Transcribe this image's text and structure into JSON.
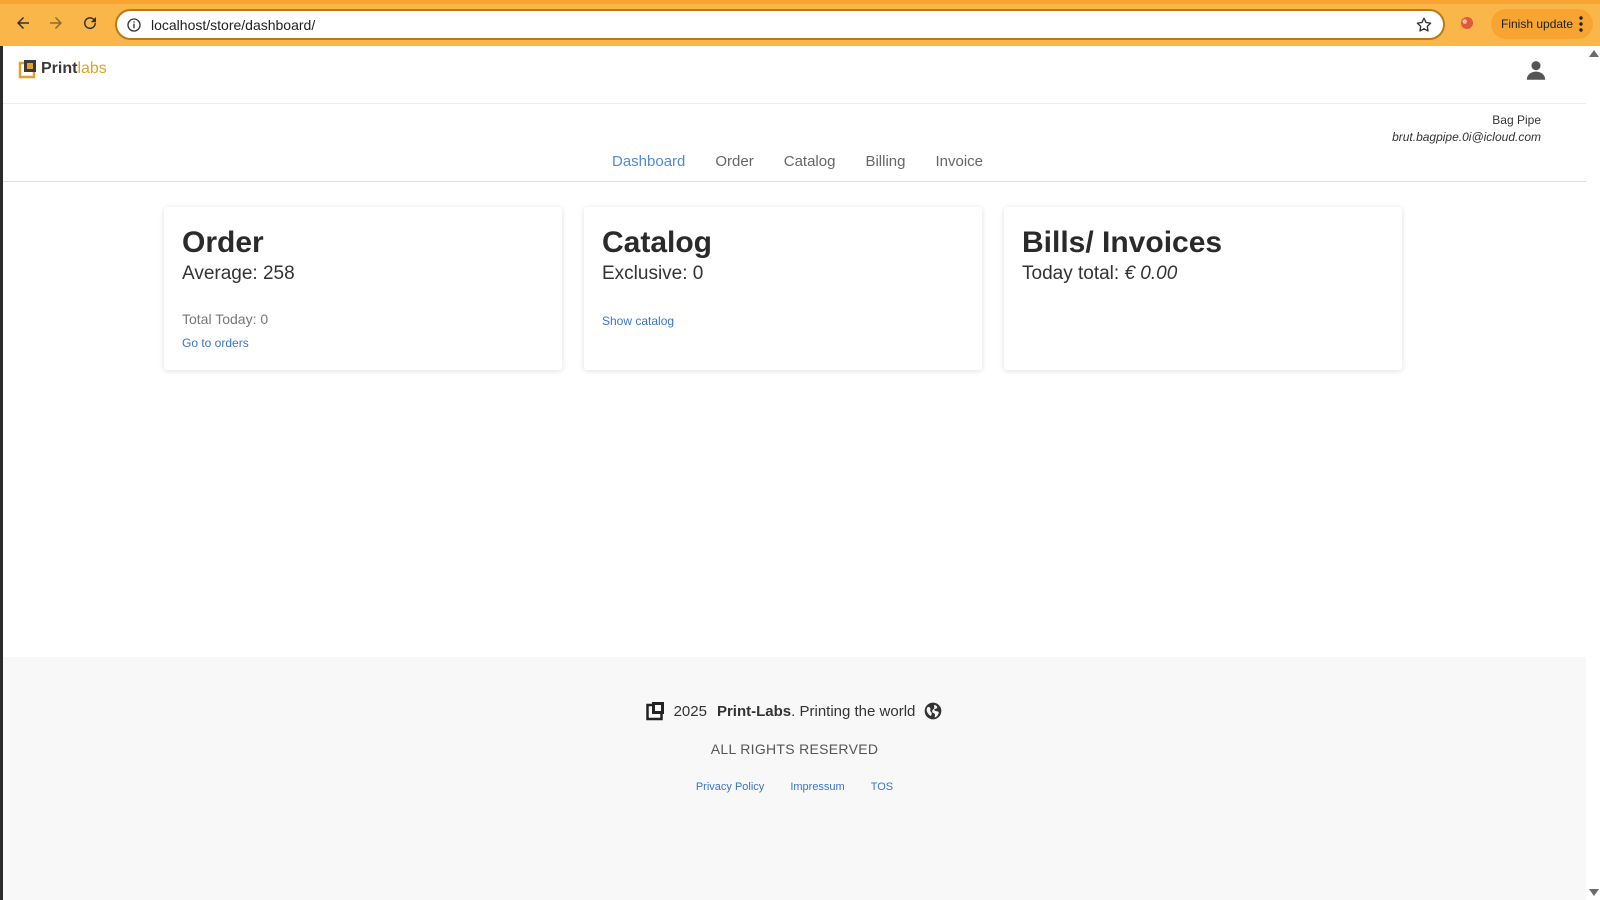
{
  "browser": {
    "url": "localhost/store/dashboard/",
    "finish_update_label": "Finish update"
  },
  "header": {
    "logo_part1": "Print",
    "logo_part2": "labs"
  },
  "user": {
    "name": "Bag Pipe",
    "email": "brut.bagpipe.0i@icloud.com"
  },
  "tabs": [
    {
      "label": "Dashboard",
      "active": true
    },
    {
      "label": "Order"
    },
    {
      "label": "Catalog"
    },
    {
      "label": "Billing"
    },
    {
      "label": "Invoice"
    }
  ],
  "cards": {
    "order": {
      "title": "Order",
      "average": "Average: 258",
      "total_today": "Total Today: 0",
      "link": "Go to orders"
    },
    "catalog": {
      "title": "Catalog",
      "exclusive": "Exclusive: 0",
      "link": "Show catalog"
    },
    "bills": {
      "title": "Bills/ Invoices",
      "today_label": "Today total:",
      "today_value": "€ 0.00"
    }
  },
  "footer": {
    "year": "2025",
    "brand": "Print-Labs",
    "tagline": ". Printing the world",
    "rights": "ALL RIGHTS RESERVED",
    "links": [
      "Privacy Policy",
      "Impressum",
      "TOS"
    ]
  },
  "colors": {
    "chrome": "#fbb64a",
    "accent_link": "#3b73c7",
    "active_tab": "#4f8bd6",
    "logo_labs": "#e0a030"
  }
}
